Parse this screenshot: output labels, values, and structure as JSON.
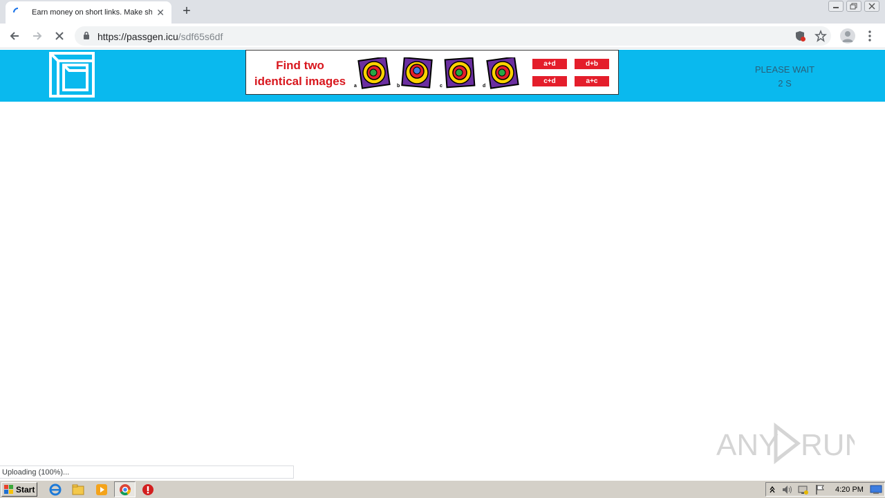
{
  "browser": {
    "tab": {
      "title": "Earn money on short links. Make sho",
      "close": "✕"
    },
    "new_tab": "+",
    "url": {
      "host": "https://passgen.icu",
      "path": "/sdf65s6df"
    }
  },
  "page": {
    "ad": {
      "headline_1": "Find two",
      "headline_2": "identical images",
      "letters": [
        "a",
        "b",
        "c",
        "d"
      ],
      "answers": [
        "a+d",
        "d+b",
        "c+d",
        "a+c"
      ]
    },
    "wait": {
      "label": "PLEASE WAIT",
      "count": "2 S"
    }
  },
  "status_bar": {
    "text": "Uploading (100%)..."
  },
  "watermark": {
    "text": "ANY RUN"
  },
  "taskbar": {
    "start_label": "Start",
    "clock": "4:20 PM"
  },
  "colors": {
    "header_bg": "#0ab9ee",
    "ad_red": "#e41e2b"
  }
}
